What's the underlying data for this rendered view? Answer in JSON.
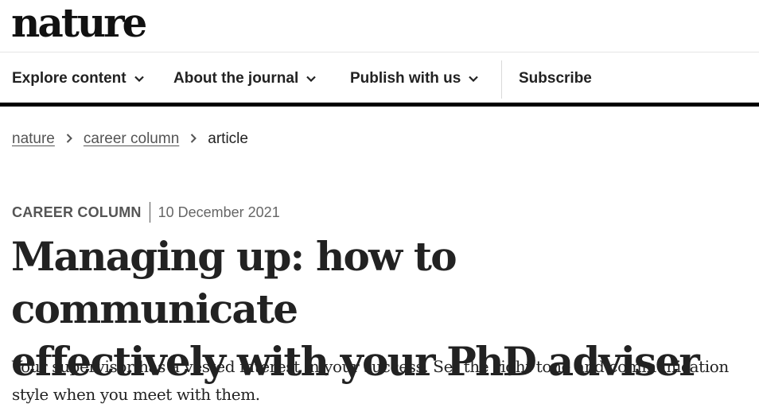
{
  "brand": {
    "logo_text": "nature"
  },
  "nav": {
    "items": [
      {
        "label": "Explore content",
        "has_dropdown": true,
        "icon": "chevron-down-icon"
      },
      {
        "label": "About the journal",
        "has_dropdown": true,
        "icon": "chevron-down-icon"
      },
      {
        "label": "Publish with us",
        "has_dropdown": true,
        "icon": "chevron-down-icon"
      },
      {
        "label": "Subscribe",
        "has_dropdown": false
      }
    ]
  },
  "breadcrumb": {
    "items": [
      "nature",
      "career column",
      "article"
    ],
    "separator_icon": "chevron-right-icon"
  },
  "article": {
    "type": "CAREER COLUMN",
    "date": "10 December 2021",
    "title_line1": "Managing up: how to communicate",
    "title_line2": "effectively with your PhD adviser",
    "standfirst_line1": "Your supervisor has a vested interest in your success. Set the right tone and communication",
    "standfirst_line2": "style when you meet with them."
  },
  "colors": {
    "text": "#222222",
    "muted": "#555555",
    "nav_bottom_border": "#000000",
    "background": "#ffffff"
  }
}
